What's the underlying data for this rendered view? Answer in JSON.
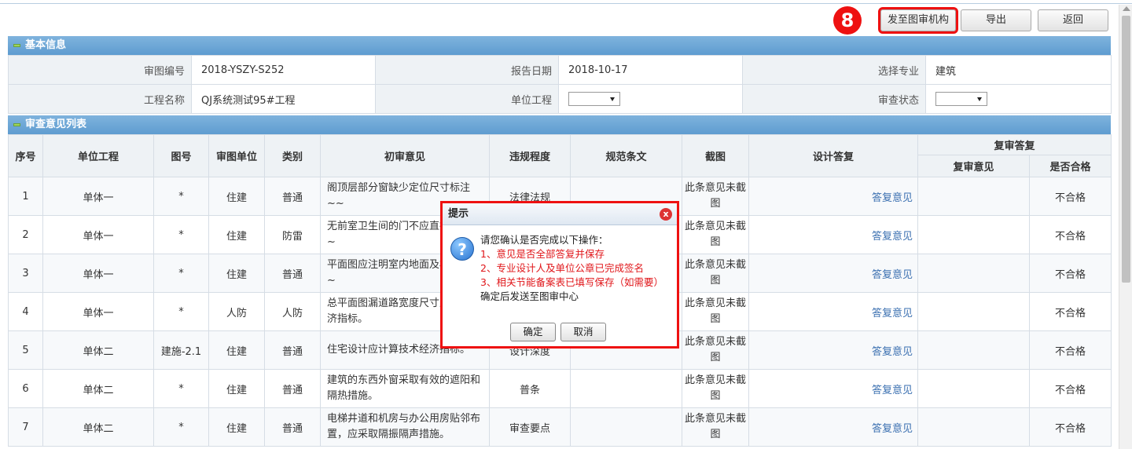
{
  "toolbar": {
    "step_number": "8",
    "send_label": "发至图审机构",
    "export_label": "导出",
    "back_label": "返回"
  },
  "basic_info": {
    "title": "基本信息",
    "review_no_label": "审图编号",
    "review_no": "2018-YSZY-S252",
    "report_date_label": "报告日期",
    "report_date": "2018-10-17",
    "specialty_label": "选择专业",
    "specialty": "建筑",
    "project_name_label": "工程名称",
    "project_name": "QJ系统测试95#工程",
    "unit_project_label": "单位工程",
    "review_status_label": "审查状态"
  },
  "opinions": {
    "title": "审查意见列表",
    "headers": {
      "no": "序号",
      "unit": "单位工程",
      "drawing": "图号",
      "org": "审图单位",
      "category": "类别",
      "opinion": "初审意见",
      "severity": "违规程度",
      "clause": "规范条文",
      "screenshot": "截图",
      "design_reply": "设计答复",
      "recheck": "复审答复",
      "recheck_opinion": "复审意见",
      "qualified": "是否合格"
    },
    "rows": [
      {
        "no": "1",
        "unit": "单体一",
        "drawing": "*",
        "org": "住建",
        "category": "普通",
        "opinion": "阁顶层部分窗缺少定位尺寸标注~~",
        "severity": "法律法规",
        "clause": "",
        "shot": "此条意见未截图",
        "reply": "答复意见",
        "recheck": "",
        "qualified": "不合格"
      },
      {
        "no": "2",
        "unit": "单体一",
        "drawing": "*",
        "org": "住建",
        "category": "防雷",
        "opinion": "无前室卫生间的门不应直接开向厅~",
        "severity": "",
        "clause": "",
        "shot": "此条意见未截图",
        "reply": "答复意见",
        "recheck": "",
        "qualified": "不合格"
      },
      {
        "no": "3",
        "unit": "单体一",
        "drawing": "*",
        "org": "住建",
        "category": "普通",
        "opinion": "平面图应注明室内地面及楼面标高~",
        "severity": "",
        "clause": "",
        "shot": "此条意见未截图",
        "reply": "答复意见",
        "recheck": "",
        "qualified": "不合格"
      },
      {
        "no": "4",
        "unit": "单体一",
        "drawing": "*",
        "org": "人防",
        "category": "人防",
        "opinion": "总平面图漏道路宽度尺寸及技术经济指标。",
        "severity": "",
        "clause": "",
        "shot": "此条意见未截图",
        "reply": "答复意见",
        "recheck": "",
        "qualified": "不合格"
      },
      {
        "no": "5",
        "unit": "单体二",
        "drawing": "建施-2.1",
        "org": "住建",
        "category": "普通",
        "opinion": "住宅设计应计算技术经济指标。",
        "severity": "设计深度",
        "clause": "",
        "shot": "此条意见未截图",
        "reply": "答复意见",
        "recheck": "",
        "qualified": "不合格"
      },
      {
        "no": "6",
        "unit": "单体二",
        "drawing": "*",
        "org": "住建",
        "category": "普通",
        "opinion": "建筑的东西外窗采取有效的遮阳和隔热措施。",
        "severity": "普条",
        "clause": "",
        "shot": "此条意见未截图",
        "reply": "答复意见",
        "recheck": "",
        "qualified": "不合格"
      },
      {
        "no": "7",
        "unit": "单体二",
        "drawing": "*",
        "org": "住建",
        "category": "普通",
        "opinion": "电梯井道和机房与办公用房贴邻布置，应采取隔振隔声措施。",
        "severity": "审查要点",
        "clause": "",
        "shot": "此条意见未截图",
        "reply": "答复意见",
        "recheck": "",
        "qualified": "不合格"
      }
    ]
  },
  "dialog": {
    "title": "提示",
    "close_glyph": "x",
    "icon_glyph": "?",
    "line_intro": "请您确认是否完成以下操作：",
    "line_1": "1、意见是否全部答复并保存",
    "line_2": "2、专业设计人及单位公章已完成签名",
    "line_3": "3、相关节能备案表已填写保存（如需要）",
    "line_confirm": "确定后发送至图审中心",
    "ok_label": "确定",
    "cancel_label": "取消"
  }
}
